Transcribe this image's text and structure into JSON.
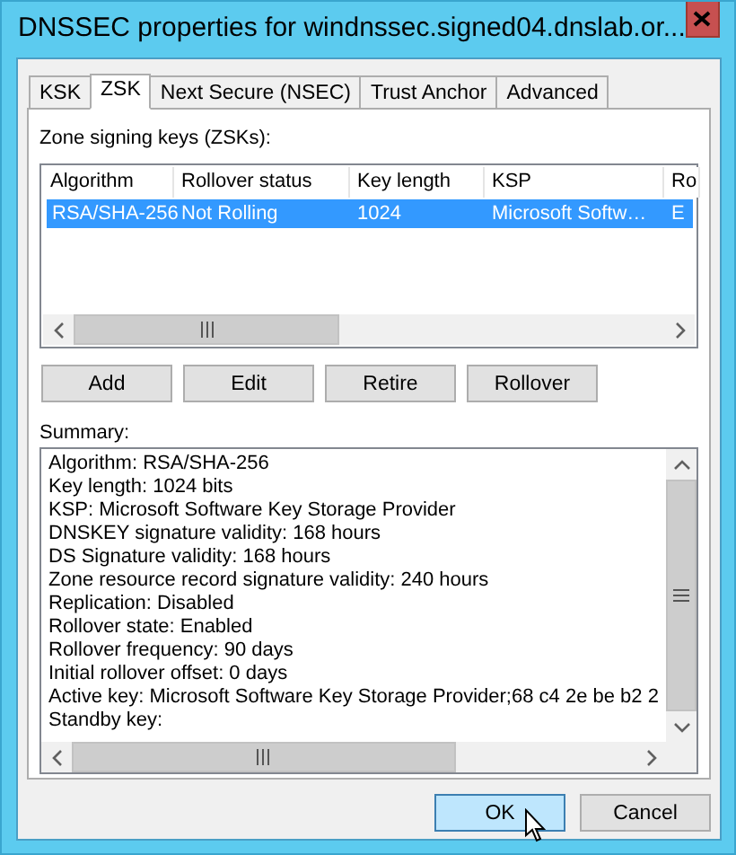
{
  "window": {
    "title": "DNSSEC properties for windnssec.signed04.dnslab.or..."
  },
  "tabs": [
    {
      "label": "KSK",
      "selected": false
    },
    {
      "label": "ZSK",
      "selected": true
    },
    {
      "label": "Next Secure (NSEC)",
      "selected": false
    },
    {
      "label": "Trust Anchor",
      "selected": false
    },
    {
      "label": "Advanced",
      "selected": false
    }
  ],
  "zsk_label": "Zone signing keys (ZSKs):",
  "keys_table": {
    "columns": [
      "Algorithm",
      "Rollover status",
      "Key length",
      "KSP",
      "Ro"
    ],
    "rows": [
      {
        "cells": [
          "RSA/SHA-256",
          "Not Rolling",
          "1024",
          "Microsoft Softw…",
          "E"
        ],
        "selected": true
      }
    ]
  },
  "key_buttons": [
    "Add",
    "Edit",
    "Retire",
    "Rollover"
  ],
  "summary_label": "Summary:",
  "summary_lines": [
    "Algorithm: RSA/SHA-256",
    "Key length: 1024 bits",
    "KSP: Microsoft Software Key Storage Provider",
    "DNSKEY signature validity: 168 hours",
    "DS Signature validity: 168 hours",
    "Zone resource record signature validity: 240 hours",
    "Replication: Disabled",
    "Rollover state: Enabled",
    "Rollover frequency: 90 days",
    "Initial rollover offset: 0 days",
    "Active key: Microsoft Software Key Storage Provider;68 c4 2e be b2 2",
    "Standby key:"
  ],
  "dialog_buttons": [
    {
      "label": "OK",
      "focused": true
    },
    {
      "label": "Cancel",
      "focused": false
    }
  ]
}
